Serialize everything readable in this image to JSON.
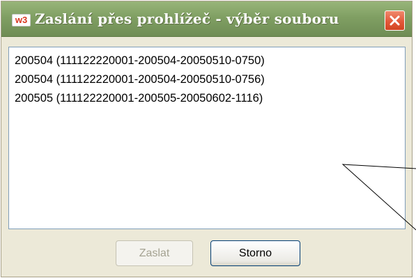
{
  "window": {
    "title": "Zaslání přes prohlížeč - výběr souboru",
    "icon_text": "w3"
  },
  "files": [
    {
      "label": "200504  (111122220001-200504-20050510-0750)"
    },
    {
      "label": "200504  (111122220001-200504-20050510-0756)"
    },
    {
      "label": "200505  (111122220001-200505-20050602-1116)"
    }
  ],
  "buttons": {
    "send_label": "Zaslat",
    "send_enabled": false,
    "cancel_label": "Storno"
  },
  "colors": {
    "titlebar": "#809f63",
    "close_button": "#e3583a",
    "dialog_background": "#ece9d8",
    "list_border": "#7f9db9"
  }
}
